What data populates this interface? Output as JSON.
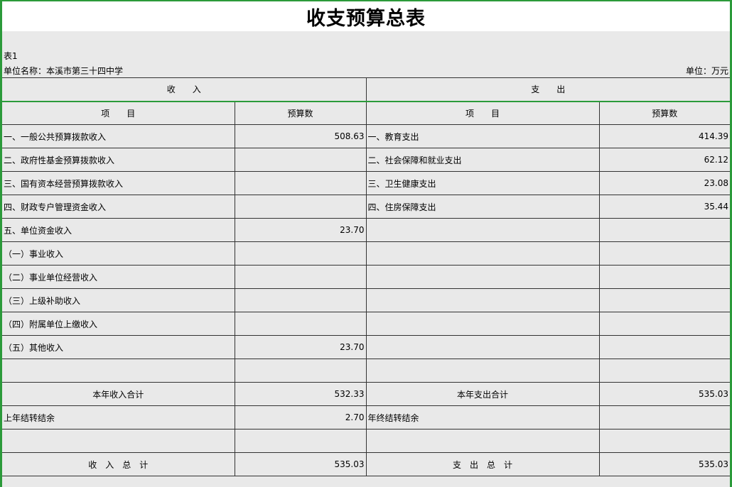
{
  "title": "收支预算总表",
  "table_no": "表1",
  "unit_name": "单位名称：本溪市第三十四中学",
  "unit": "单位：万元",
  "header": {
    "income": "收　　入",
    "expense": "支　　出",
    "item": "项　　目",
    "budget": "预算数"
  },
  "rows": [
    {
      "in_item": "一、一般公共预算拨款收入",
      "in_val": "508.63",
      "ex_item": "一、教育支出",
      "ex_val": "414.39"
    },
    {
      "in_item": "二、政府性基金预算拨款收入",
      "in_val": "",
      "ex_item": "二、社会保障和就业支出",
      "ex_val": "62.12"
    },
    {
      "in_item": "三、国有资本经营预算拨款收入",
      "in_val": "",
      "ex_item": "三、卫生健康支出",
      "ex_val": "23.08"
    },
    {
      "in_item": "四、财政专户管理资金收入",
      "in_val": "",
      "ex_item": "四、住房保障支出",
      "ex_val": "35.44"
    },
    {
      "in_item": "五、单位资金收入",
      "in_val": "23.70",
      "ex_item": "",
      "ex_val": ""
    },
    {
      "in_item": "（一）事业收入",
      "in_val": "",
      "ex_item": "",
      "ex_val": ""
    },
    {
      "in_item": "（二）事业单位经营收入",
      "in_val": "",
      "ex_item": "",
      "ex_val": ""
    },
    {
      "in_item": "（三）上级补助收入",
      "in_val": "",
      "ex_item": "",
      "ex_val": ""
    },
    {
      "in_item": "（四）附属单位上缴收入",
      "in_val": "",
      "ex_item": "",
      "ex_val": ""
    },
    {
      "in_item": "（五）其他收入",
      "in_val": "23.70",
      "ex_item": "",
      "ex_val": ""
    },
    {
      "in_item": "",
      "in_val": "",
      "ex_item": "",
      "ex_val": ""
    }
  ],
  "totals": {
    "year_income_label": "本年收入合计",
    "year_income": "532.33",
    "year_expense_label": "本年支出合计",
    "year_expense": "535.03",
    "carry_in_label": "上年结转结余",
    "carry_in": "2.70",
    "carry_out_label": "年终结转结余",
    "carry_out": "",
    "grand_income_label": "收　入　总　计",
    "grand_income": "535.03",
    "grand_expense_label": "支　出　总　计",
    "grand_expense": "535.03"
  }
}
